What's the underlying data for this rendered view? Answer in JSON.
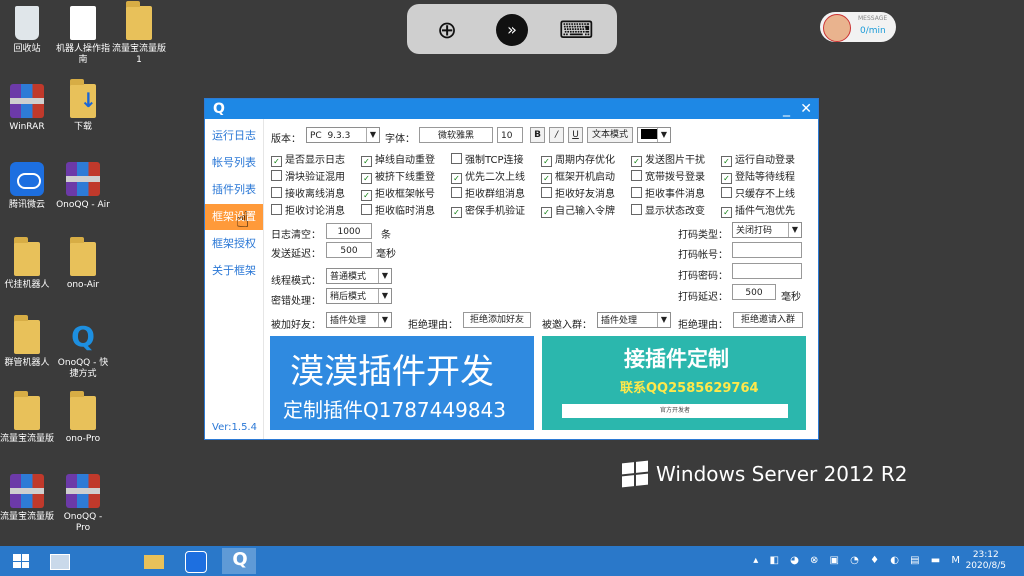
{
  "desktop_icons": [
    {
      "label": "回收站",
      "icon": "recycle-bin-icon"
    },
    {
      "label": "机器人操作指南",
      "icon": "document-icon"
    },
    {
      "label": "流量宝流量版1",
      "icon": "folder-icon"
    },
    {
      "label": "WinRAR",
      "icon": "winrar-icon"
    },
    {
      "label": "下载",
      "icon": "download-folder-icon"
    },
    {
      "label": "腾讯微云",
      "icon": "weiyun-icon"
    },
    {
      "label": "OnoQQ - Air",
      "icon": "winrar-icon"
    },
    {
      "label": "代挂机器人",
      "icon": "folder-icon"
    },
    {
      "label": "ono-Air",
      "icon": "folder-icon"
    },
    {
      "label": "群管机器人",
      "icon": "folder-icon"
    },
    {
      "label": "OnoQQ - 快捷方式",
      "icon": "onoqq-icon"
    },
    {
      "label": "流量宝流量版",
      "icon": "folder-icon"
    },
    {
      "label": "ono-Pro",
      "icon": "folder-icon"
    },
    {
      "label": "流量宝流量版",
      "icon": "winrar-icon"
    },
    {
      "label": "OnoQQ - Pro",
      "icon": "winrar-icon"
    }
  ],
  "remote_toolbar": {
    "zoom": "⊕",
    "rdp": "»",
    "keyboard": "⌨"
  },
  "message_widget": {
    "title": "MESSAGE",
    "rate": "0/min"
  },
  "brand": {
    "text": "Windows Server 2012 R2"
  },
  "app": {
    "sidebar": [
      "运行日志",
      "帐号列表",
      "插件列表",
      "框架设置",
      "框架授权",
      "关于框架"
    ],
    "active_index": 3,
    "version": "Ver:1.5.4",
    "top": {
      "version_label": "版本：",
      "platform": "PC",
      "version_value": "9.3.3",
      "font_label": "字体：",
      "font_value": "微软雅黑",
      "font_size": "10",
      "bold": "B",
      "italic": "/",
      "underline": "U",
      "text_mode": "文本模式"
    },
    "checkboxes": [
      [
        "是否显示日志",
        "掉线自动重登",
        "强制TCP连接",
        "周期内存优化",
        "发送图片干扰",
        "运行自动登录"
      ],
      [
        "滑块验证混用",
        "被挤下线重登",
        "优先二次上线",
        "框架开机启动",
        "宽带拨号登录",
        "登陆等待线程"
      ],
      [
        "接收离线消息",
        "拒收框架帐号",
        "拒收群组消息",
        "拒收好友消息",
        "拒收事件消息",
        "只缓存不上线"
      ],
      [
        "拒收讨论消息",
        "拒收临时消息",
        "密保手机验证",
        "自己输入令牌",
        "显示状态改变",
        "插件气泡优先"
      ]
    ],
    "checked": [
      [
        true,
        true,
        false,
        true,
        true,
        true
      ],
      [
        false,
        true,
        true,
        true,
        false,
        true
      ],
      [
        false,
        true,
        false,
        false,
        false,
        false
      ],
      [
        false,
        false,
        true,
        true,
        false,
        true
      ]
    ],
    "log_clear_label": "日志清空：",
    "log_clear_value": "1000",
    "log_clear_unit": "条",
    "send_delay_label": "发送延迟：",
    "send_delay_value": "500",
    "send_delay_unit": "毫秒",
    "thread_label": "线程模式：",
    "thread_value": "普通模式",
    "error_label": "密错处理：",
    "error_value": "稍后模式",
    "captcha_type_label": "打码类型：",
    "captcha_type_value": "关闭打码",
    "captcha_account_label": "打码帐号：",
    "captcha_password_label": "打码密码：",
    "captcha_delay_label": "打码延迟：",
    "captcha_delay_value": "500",
    "captcha_delay_unit": "毫秒",
    "friend_added_label": "被加好友：",
    "friend_added_value": "插件处理",
    "reject_reason_label": "拒绝理由：",
    "reject_friend_button": "拒绝添加好友",
    "group_invited_label": "被邀入群：",
    "group_invited_value": "插件处理",
    "reject_reason_label2": "拒绝理由：",
    "reject_group_button": "拒绝邀请入群",
    "banner1": {
      "line1": "漠漠插件开发",
      "line2": "定制插件Q1787449843"
    },
    "banner2": {
      "line1": "接插件定制",
      "line2": "联系QQ2585629764",
      "line3": "官方开发者"
    }
  },
  "taskbar": {
    "date": "2020/8/5",
    "time": "23:12"
  }
}
